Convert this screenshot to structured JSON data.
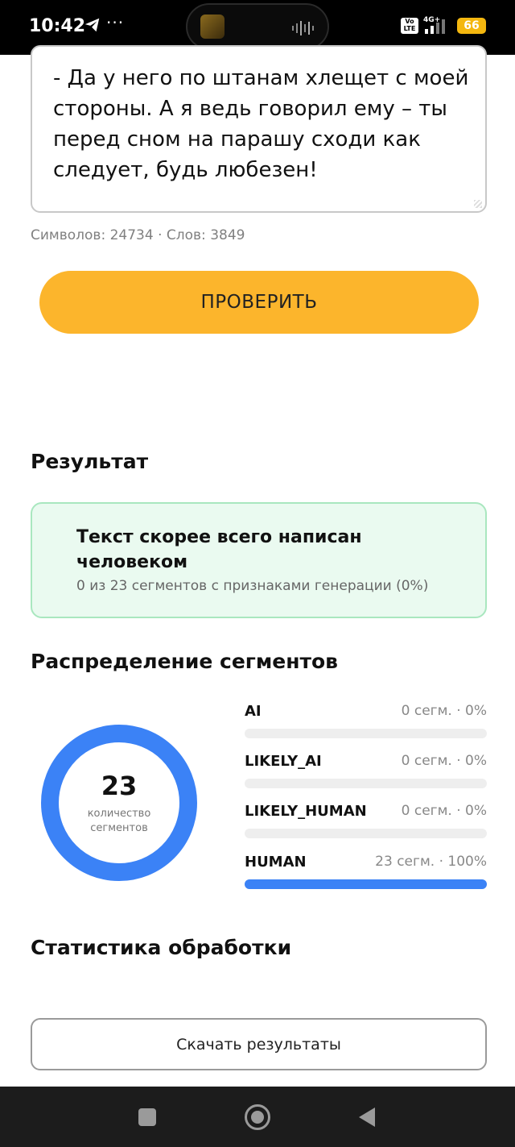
{
  "status_bar": {
    "time": "10:42",
    "dots": "···",
    "volte_line1": "Vo",
    "volte_line2": "LTE",
    "network": "4G+",
    "battery": "66"
  },
  "editor": {
    "text": "- Да у него по штанам хлещет с моей стороны. А я ведь говорил ему – ты перед сном на парашу сходи как следует, будь любезен!"
  },
  "counts": {
    "chars_label": "Символов:",
    "chars_value": "24734",
    "separator": " · ",
    "words_label": "Слов:",
    "words_value": "3849"
  },
  "check_button": "ПРОВЕРИТЬ",
  "result": {
    "heading": "Результат",
    "title": "Текст скорее всего написан человеком",
    "subtitle": "0 из 23 сегментов с признаками генерации (0%)"
  },
  "distribution": {
    "heading": "Распределение сегментов",
    "total": "23",
    "total_label_line1": "количество",
    "total_label_line2": "сегментов",
    "segments": [
      {
        "name": "AI",
        "value": "0 сегм. · 0%",
        "fraction": 0,
        "color": "#3b82f6"
      },
      {
        "name": "LIKELY_AI",
        "value": "0 сегм. · 0%",
        "fraction": 0,
        "color": "#3b82f6"
      },
      {
        "name": "LIKELY_HUMAN",
        "value": "0 сегм. · 0%",
        "fraction": 0,
        "color": "#3b82f6"
      },
      {
        "name": "HUMAN",
        "value": "23 сегм. · 100%",
        "fraction": 1,
        "color": "#3b82f6"
      }
    ],
    "donut_color": "#3b82f6"
  },
  "stats_heading": "Статистика обработки",
  "download_button": "Скачать результаты",
  "colors": {
    "accent_button": "#fcb52c",
    "result_bg": "#eafaf0",
    "result_border": "#a9e7bf"
  },
  "icons": {
    "telegram": "telegram-icon",
    "signal": "signal-icon",
    "nav_recents": "square-icon",
    "nav_home": "home-circle-icon",
    "nav_back": "back-triangle-icon"
  }
}
